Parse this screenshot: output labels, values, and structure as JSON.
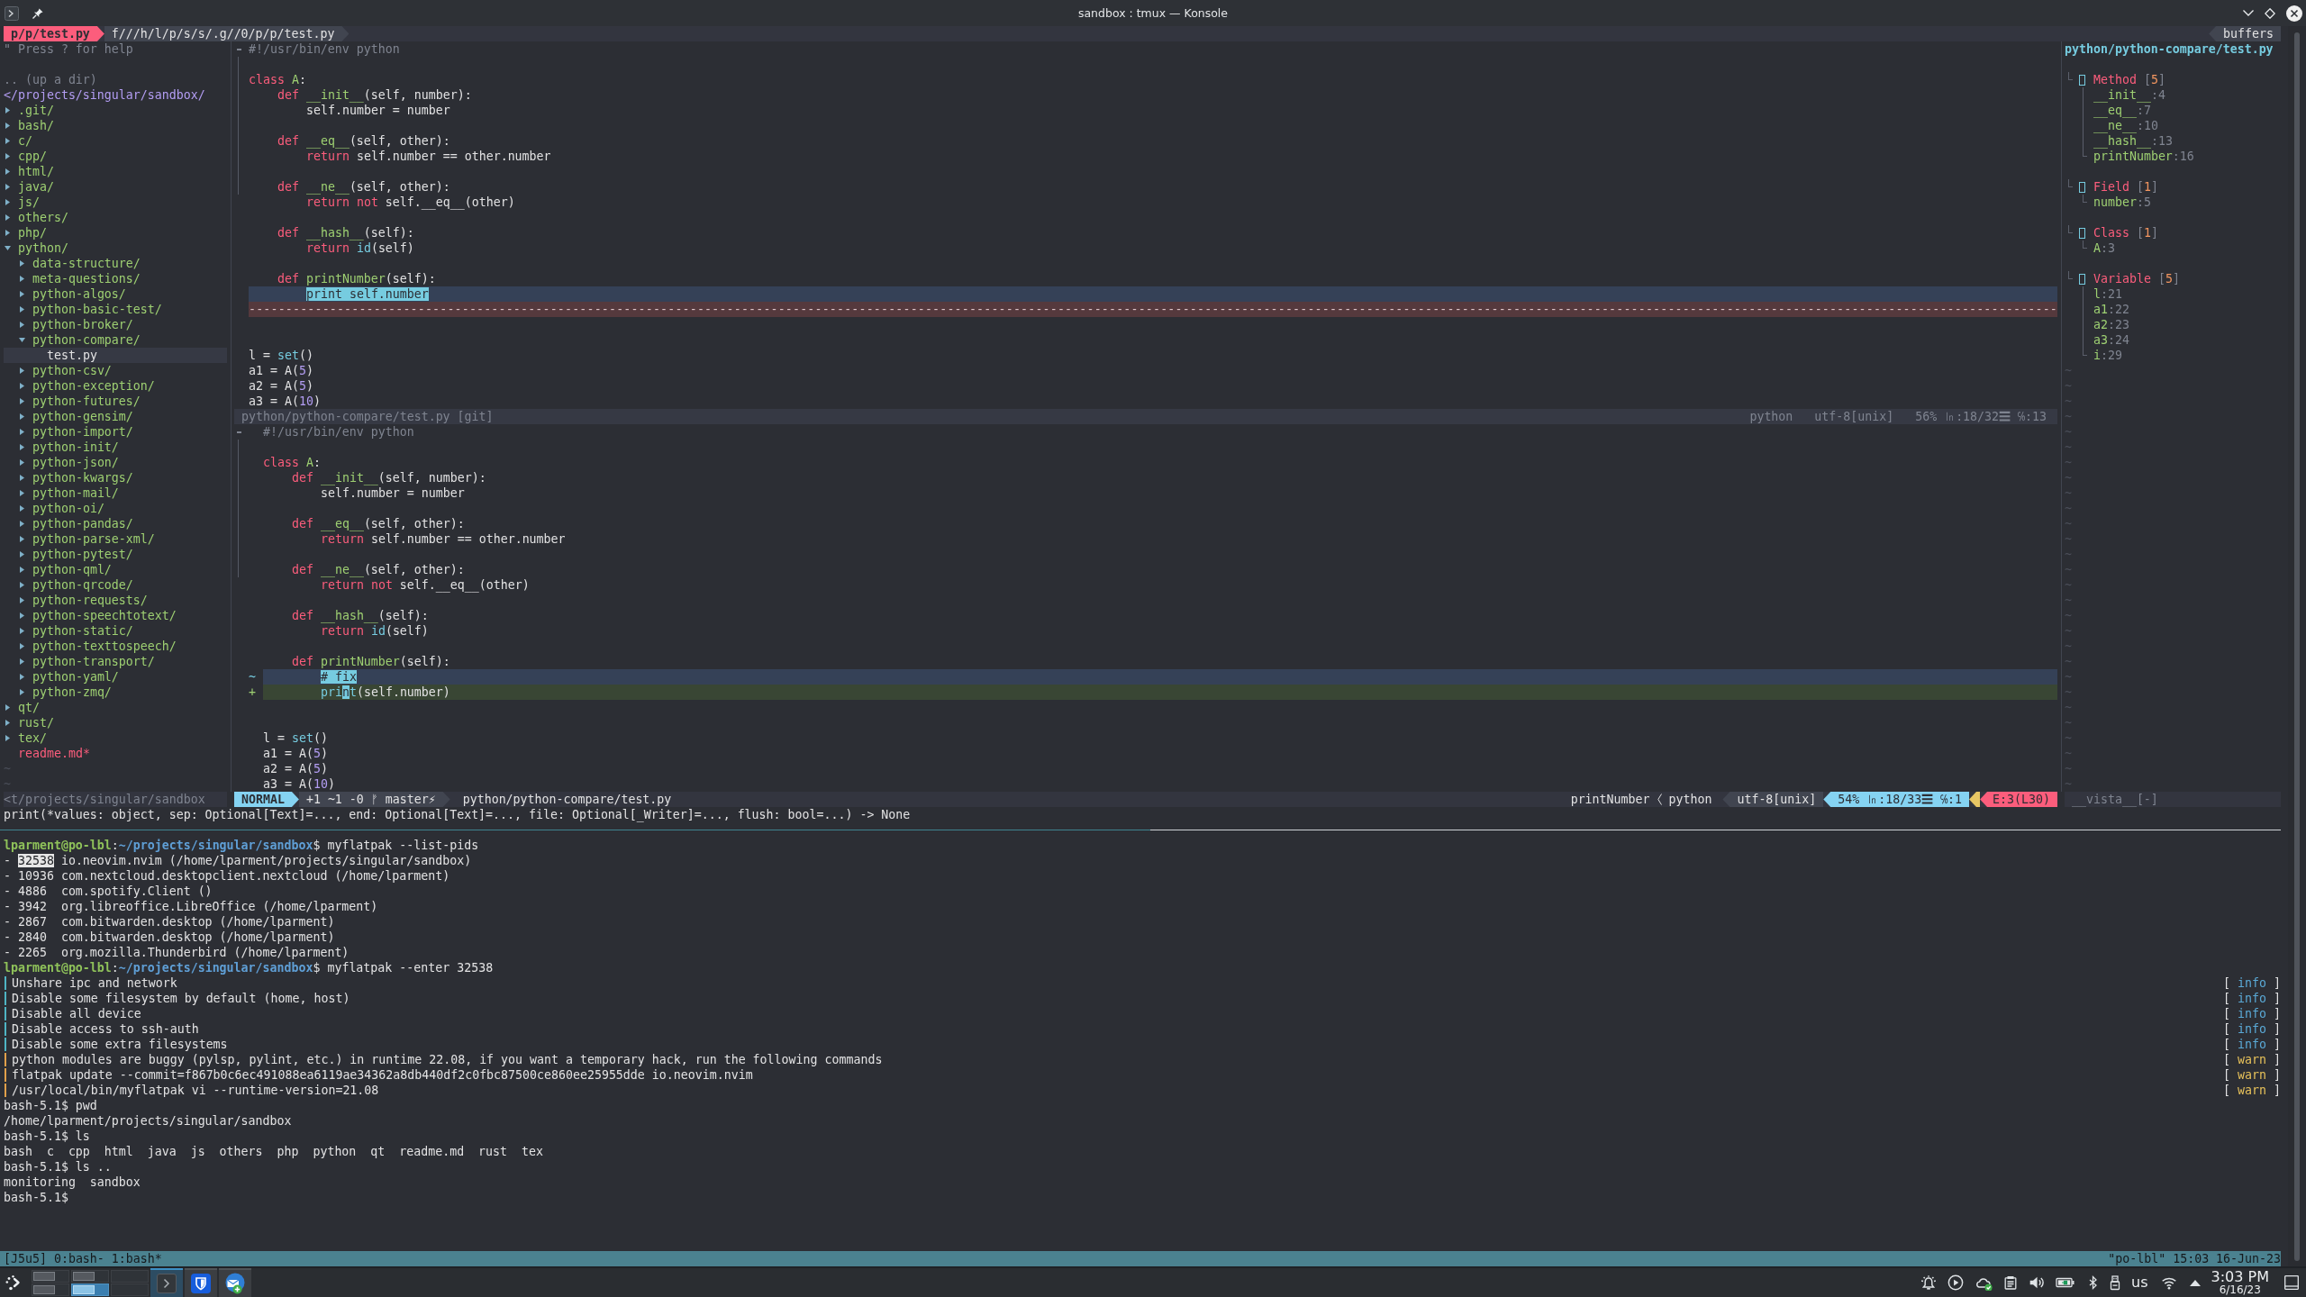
{
  "window": {
    "title": "sandbox : tmux — Konsole"
  },
  "tabline": {
    "tabs": [
      {
        "label": "p/p/test.py",
        "selected": true
      },
      {
        "label": "f///h/l/p/s/s/.g//0/p/p/test.py",
        "selected": false
      }
    ],
    "right_label": "buffers"
  },
  "file_tree": {
    "help": "\" Press ? for help",
    "up_dir": ".. (up a dir)",
    "root": "</projects/singular/sandbox/",
    "items": [
      {
        "kind": "folder",
        "name": ".git/",
        "expanded": false,
        "selected": false
      },
      {
        "kind": "folder",
        "name": "bash/",
        "expanded": false,
        "selected": false
      },
      {
        "kind": "folder",
        "name": "c/",
        "expanded": false,
        "selected": false
      },
      {
        "kind": "folder",
        "name": "cpp/",
        "expanded": false,
        "selected": false
      },
      {
        "kind": "folder",
        "name": "html/",
        "expanded": false,
        "selected": false
      },
      {
        "kind": "folder",
        "name": "java/",
        "expanded": false,
        "selected": false
      },
      {
        "kind": "folder",
        "name": "js/",
        "expanded": false,
        "selected": false
      },
      {
        "kind": "folder",
        "name": "others/",
        "expanded": false,
        "selected": false
      },
      {
        "kind": "folder",
        "name": "php/",
        "expanded": false,
        "selected": false
      },
      {
        "kind": "folder",
        "name": "python/",
        "expanded": true,
        "selected": false,
        "children": [
          {
            "kind": "folder",
            "name": "data-structure/",
            "expanded": false,
            "selected": false
          },
          {
            "kind": "folder",
            "name": "meta-questions/",
            "expanded": false,
            "selected": false
          },
          {
            "kind": "folder",
            "name": "python-algos/",
            "expanded": false,
            "selected": false
          },
          {
            "kind": "folder",
            "name": "python-basic-test/",
            "expanded": false,
            "selected": false
          },
          {
            "kind": "folder",
            "name": "python-broker/",
            "expanded": false,
            "selected": false
          },
          {
            "kind": "folder",
            "name": "python-compare/",
            "expanded": true,
            "selected": false,
            "children": [
              {
                "kind": "file",
                "name": "test.py",
                "selected": true,
                "color": "#e2e2e3"
              }
            ]
          },
          {
            "kind": "folder",
            "name": "python-csv/",
            "expanded": false,
            "selected": false
          },
          {
            "kind": "folder",
            "name": "python-exception/",
            "expanded": false,
            "selected": false
          },
          {
            "kind": "folder",
            "name": "python-futures/",
            "expanded": false,
            "selected": false
          },
          {
            "kind": "folder",
            "name": "python-gensim/",
            "expanded": false,
            "selected": false
          },
          {
            "kind": "folder",
            "name": "python-import/",
            "expanded": false,
            "selected": false
          },
          {
            "kind": "folder",
            "name": "python-init/",
            "expanded": false,
            "selected": false
          },
          {
            "kind": "folder",
            "name": "python-json/",
            "expanded": false,
            "selected": false
          },
          {
            "kind": "folder",
            "name": "python-kwargs/",
            "expanded": false,
            "selected": false
          },
          {
            "kind": "folder",
            "name": "python-mail/",
            "expanded": false,
            "selected": false
          },
          {
            "kind": "folder",
            "name": "python-oi/",
            "expanded": false,
            "selected": false
          },
          {
            "kind": "folder",
            "name": "python-pandas/",
            "expanded": false,
            "selected": false
          },
          {
            "kind": "folder",
            "name": "python-parse-xml/",
            "expanded": false,
            "selected": false
          },
          {
            "kind": "folder",
            "name": "python-pytest/",
            "expanded": false,
            "selected": false
          },
          {
            "kind": "folder",
            "name": "python-qml/",
            "expanded": false,
            "selected": false
          },
          {
            "kind": "folder",
            "name": "python-qrcode/",
            "expanded": false,
            "selected": false
          },
          {
            "kind": "folder",
            "name": "python-requests/",
            "expanded": false,
            "selected": false
          },
          {
            "kind": "folder",
            "name": "python-speechtotext/",
            "expanded": false,
            "selected": false
          },
          {
            "kind": "folder",
            "name": "python-static/",
            "expanded": false,
            "selected": false
          },
          {
            "kind": "folder",
            "name": "python-texttospeech/",
            "expanded": false,
            "selected": false
          },
          {
            "kind": "folder",
            "name": "python-transport/",
            "expanded": false,
            "selected": false
          },
          {
            "kind": "folder",
            "name": "python-yaml/",
            "expanded": false,
            "selected": false
          },
          {
            "kind": "folder",
            "name": "python-zmq/",
            "expanded": false,
            "selected": false
          }
        ]
      },
      {
        "kind": "folder",
        "name": "qt/",
        "expanded": false,
        "selected": false
      },
      {
        "kind": "folder",
        "name": "rust/",
        "expanded": false,
        "selected": false
      },
      {
        "kind": "folder",
        "name": "tex/",
        "expanded": false,
        "selected": false
      },
      {
        "kind": "file",
        "name": "readme.md*",
        "selected": false,
        "color": "#fc5d7c"
      }
    ],
    "filler": [
      "~",
      "~"
    ],
    "status": "<t/projects/singular/sandbox"
  },
  "editor": {
    "windows": [
      {
        "active": false,
        "lines": [
          {
            "kind": "code",
            "fold_start": true,
            "tokens": [
              {
                "kind": "comment",
                "text": "#!/usr/bin/env python"
              }
            ]
          },
          {
            "kind": "blank",
            "in_fold": true
          },
          {
            "kind": "code",
            "in_fold": true,
            "tokens": [
              {
                "kind": "keyword",
                "text": "class "
              },
              {
                "kind": "function",
                "text": "A"
              },
              {
                "kind": "plain",
                "text": ":"
              }
            ],
            "children": [
              {
                "kind": "code",
                "in_fold": true,
                "tokens": [
                  {
                    "kind": "keyword",
                    "text": "def "
                  },
                  {
                    "kind": "function",
                    "text": "__init__"
                  },
                  {
                    "kind": "plain",
                    "text": "(self, number):"
                  }
                ],
                "children": [
                  {
                    "kind": "code",
                    "in_fold": true,
                    "tokens": [
                      {
                        "kind": "plain",
                        "text": "self.number = number"
                      }
                    ]
                  }
                ]
              },
              {
                "kind": "blank",
                "in_fold": true
              },
              {
                "kind": "code",
                "in_fold": true,
                "tokens": [
                  {
                    "kind": "keyword",
                    "text": "def "
                  },
                  {
                    "kind": "function",
                    "text": "__eq__"
                  },
                  {
                    "kind": "plain",
                    "text": "(self, other):"
                  }
                ],
                "children": [
                  {
                    "kind": "code",
                    "in_fold": true,
                    "tokens": [
                      {
                        "kind": "keyword",
                        "text": "return"
                      },
                      {
                        "kind": "plain",
                        "text": " self.number == other.number"
                      }
                    ]
                  }
                ]
              },
              {
                "kind": "blank",
                "in_fold": true
              },
              {
                "kind": "code",
                "in_fold": true,
                "tokens": [
                  {
                    "kind": "keyword",
                    "text": "def "
                  },
                  {
                    "kind": "function",
                    "text": "__ne__"
                  },
                  {
                    "kind": "plain",
                    "text": "(self, other):"
                  }
                ],
                "children": [
                  {
                    "kind": "code",
                    "tokens": [
                      {
                        "kind": "keyword",
                        "text": "return not"
                      },
                      {
                        "kind": "plain",
                        "text": " self.__eq__(other)"
                      }
                    ]
                  }
                ]
              },
              {
                "kind": "blank"
              },
              {
                "kind": "code",
                "tokens": [
                  {
                    "kind": "keyword",
                    "text": "def "
                  },
                  {
                    "kind": "function",
                    "text": "__hash__"
                  },
                  {
                    "kind": "plain",
                    "text": "(self):"
                  }
                ],
                "children": [
                  {
                    "kind": "code",
                    "tokens": [
                      {
                        "kind": "keyword",
                        "text": "return "
                      },
                      {
                        "kind": "builtin",
                        "text": "id"
                      },
                      {
                        "kind": "plain",
                        "text": "(self)"
                      }
                    ]
                  }
                ]
              },
              {
                "kind": "blank"
              },
              {
                "kind": "code",
                "tokens": [
                  {
                    "kind": "keyword",
                    "text": "def "
                  },
                  {
                    "kind": "function",
                    "text": "printNumber"
                  },
                  {
                    "kind": "plain",
                    "text": "(self):"
                  }
                ],
                "children": [
                  {
                    "kind": "changed",
                    "tokens": [
                      {
                        "kind": "diff-text",
                        "text": "print self.number"
                      }
                    ]
                  }
                ]
              }
            ]
          },
          {
            "kind": "filler",
            "text": "------------------------------------------------------------------------------------------------------------------------------------------------------------------------------------------------------------------------------------------------------"
          },
          {
            "kind": "blank"
          },
          {
            "kind": "blank"
          },
          {
            "kind": "code",
            "tokens": [
              {
                "kind": "plain",
                "text": "l = "
              },
              {
                "kind": "builtin",
                "text": "set"
              },
              {
                "kind": "plain",
                "text": "()"
              }
            ]
          },
          {
            "kind": "code",
            "tokens": [
              {
                "kind": "plain",
                "text": "a1 = A("
              },
              {
                "kind": "number",
                "text": "5"
              },
              {
                "kind": "plain",
                "text": ")"
              }
            ]
          },
          {
            "kind": "code",
            "tokens": [
              {
                "kind": "plain",
                "text": "a2 = A("
              },
              {
                "kind": "number",
                "text": "5"
              },
              {
                "kind": "plain",
                "text": ")"
              }
            ]
          },
          {
            "kind": "code",
            "tokens": [
              {
                "kind": "plain",
                "text": "a3 = A("
              },
              {
                "kind": "number",
                "text": "10"
              },
              {
                "kind": "plain",
                "text": ")"
              }
            ]
          }
        ],
        "status": {
          "left": [
            {
              "kind": "file",
              "text": "python/python-compare/test.py [git]"
            }
          ],
          "right": [
            {
              "kind": "filetype",
              "text": "python"
            },
            {
              "kind": "encoding",
              "text": "utf-8[unix]"
            },
            {
              "kind": "position",
              "text": "56% ㏑:18/32☰ ℅:13"
            }
          ]
        }
      },
      {
        "active": true,
        "lines": [
          {
            "kind": "code",
            "fold_start": true,
            "tokens": [
              {
                "kind": "comment",
                "text": "#!/usr/bin/env python"
              }
            ]
          },
          {
            "kind": "blank",
            "in_fold": true
          },
          {
            "kind": "code",
            "in_fold": true,
            "tokens": [
              {
                "kind": "keyword",
                "text": "class "
              },
              {
                "kind": "function",
                "text": "A"
              },
              {
                "kind": "plain",
                "text": ":"
              }
            ],
            "children": [
              {
                "kind": "code",
                "in_fold": true,
                "tokens": [
                  {
                    "kind": "keyword",
                    "text": "def "
                  },
                  {
                    "kind": "function",
                    "text": "__init__"
                  },
                  {
                    "kind": "plain",
                    "text": "(self, number):"
                  }
                ],
                "children": [
                  {
                    "kind": "code",
                    "in_fold": true,
                    "tokens": [
                      {
                        "kind": "plain",
                        "text": "self.number = number"
                      }
                    ]
                  }
                ]
              },
              {
                "kind": "blank",
                "in_fold": true
              },
              {
                "kind": "code",
                "in_fold": true,
                "tokens": [
                  {
                    "kind": "keyword",
                    "text": "def "
                  },
                  {
                    "kind": "function",
                    "text": "__eq__"
                  },
                  {
                    "kind": "plain",
                    "text": "(self, other):"
                  }
                ],
                "children": [
                  {
                    "kind": "code",
                    "in_fold": true,
                    "tokens": [
                      {
                        "kind": "keyword",
                        "text": "return"
                      },
                      {
                        "kind": "plain",
                        "text": " self.number == other.number"
                      }
                    ]
                  }
                ]
              },
              {
                "kind": "blank",
                "in_fold": true
              },
              {
                "kind": "code",
                "in_fold": true,
                "tokens": [
                  {
                    "kind": "keyword",
                    "text": "def "
                  },
                  {
                    "kind": "function",
                    "text": "__ne__"
                  },
                  {
                    "kind": "plain",
                    "text": "(self, other):"
                  }
                ],
                "children": [
                  {
                    "kind": "code",
                    "tokens": [
                      {
                        "kind": "keyword",
                        "text": "return not"
                      },
                      {
                        "kind": "plain",
                        "text": " self.__eq__(other)"
                      }
                    ]
                  }
                ]
              },
              {
                "kind": "blank"
              },
              {
                "kind": "code",
                "tokens": [
                  {
                    "kind": "keyword",
                    "text": "def "
                  },
                  {
                    "kind": "function",
                    "text": "__hash__"
                  },
                  {
                    "kind": "plain",
                    "text": "(self):"
                  }
                ],
                "children": [
                  {
                    "kind": "code",
                    "tokens": [
                      {
                        "kind": "keyword",
                        "text": "return "
                      },
                      {
                        "kind": "builtin",
                        "text": "id"
                      },
                      {
                        "kind": "plain",
                        "text": "(self)"
                      }
                    ]
                  }
                ]
              },
              {
                "kind": "blank"
              },
              {
                "kind": "code",
                "tokens": [
                  {
                    "kind": "keyword",
                    "text": "def "
                  },
                  {
                    "kind": "function",
                    "text": "printNumber"
                  },
                  {
                    "kind": "plain",
                    "text": "(self):"
                  }
                ],
                "children": [
                  {
                    "kind": "changed",
                    "sign": "~",
                    "tokens": [
                      {
                        "kind": "diff-text",
                        "text": "# fix"
                      }
                    ]
                  },
                  {
                    "kind": "added",
                    "sign": "+",
                    "tokens": [
                      {
                        "kind": "builtin",
                        "text": "pri"
                      },
                      {
                        "kind": "cursor",
                        "text": "n"
                      },
                      {
                        "kind": "builtin",
                        "text": "t"
                      },
                      {
                        "kind": "plain",
                        "text": "(self.number)"
                      }
                    ]
                  }
                ]
              }
            ]
          },
          {
            "kind": "blank"
          },
          {
            "kind": "blank"
          },
          {
            "kind": "code",
            "tokens": [
              {
                "kind": "plain",
                "text": "l = "
              },
              {
                "kind": "builtin",
                "text": "set"
              },
              {
                "kind": "plain",
                "text": "()"
              }
            ]
          },
          {
            "kind": "code",
            "tokens": [
              {
                "kind": "plain",
                "text": "a1 = A("
              },
              {
                "kind": "number",
                "text": "5"
              },
              {
                "kind": "plain",
                "text": ")"
              }
            ]
          },
          {
            "kind": "code",
            "tokens": [
              {
                "kind": "plain",
                "text": "a2 = A("
              },
              {
                "kind": "number",
                "text": "5"
              },
              {
                "kind": "plain",
                "text": ")"
              }
            ]
          },
          {
            "kind": "code",
            "tokens": [
              {
                "kind": "plain",
                "text": "a3 = A("
              },
              {
                "kind": "number",
                "text": "10"
              },
              {
                "kind": "plain",
                "text": ")"
              }
            ]
          }
        ],
        "status": {
          "left": [
            {
              "kind": "mode",
              "text": "NORMAL"
            },
            {
              "kind": "git",
              "text": "+1 ~1 -0 ᚠ master⚡"
            },
            {
              "kind": "file",
              "text": "python/python-compare/test.py"
            }
          ],
          "right": [
            {
              "kind": "tag",
              "text": "printNumber"
            },
            {
              "kind": "filetype",
              "text": "python"
            },
            {
              "kind": "encoding",
              "text": "utf-8[unix]"
            },
            {
              "kind": "position",
              "text": "54% ㏑:18/33☰ ℅:1"
            },
            {
              "kind": "warning"
            },
            {
              "kind": "error",
              "text": "E:3(L30)"
            }
          ]
        }
      }
    ]
  },
  "tag_panel": {
    "title": "python/python-compare/test.py",
    "groups": [
      {
        "name": "Method",
        "count": "[5]",
        "children": [
          {
            "name": "__init__",
            "location": ":4"
          },
          {
            "name": "__eq__",
            "location": ":7"
          },
          {
            "name": "__ne__",
            "location": ":10"
          },
          {
            "name": "__hash__",
            "location": ":13"
          },
          {
            "name": "printNumber",
            "location": ":16"
          }
        ]
      },
      {
        "name": "Field",
        "count": "[1]",
        "children": [
          {
            "name": "number",
            "location": ":5"
          }
        ]
      },
      {
        "name": "Class",
        "count": "[1]",
        "children": [
          {
            "name": "A",
            "location": ":3"
          }
        ]
      },
      {
        "name": "Variable",
        "count": "[5]",
        "children": [
          {
            "name": "l",
            "location": ":21"
          },
          {
            "name": "a1",
            "location": ":22"
          },
          {
            "name": "a2",
            "location": ":23"
          },
          {
            "name": "a3",
            "location": ":24"
          },
          {
            "name": "i",
            "location": ":29"
          }
        ]
      }
    ],
    "filler": [
      "~",
      "~",
      "~",
      "~",
      "~",
      "~",
      "~",
      "~",
      "~",
      "~",
      "~",
      "~",
      "~",
      "~",
      "~",
      "~",
      "~",
      "~",
      "~",
      "~",
      "~",
      "~",
      "~",
      "~",
      "~",
      "~",
      "~",
      "~"
    ],
    "status": "__vista__[-]"
  },
  "command_line": "print(*values: object, sep: Optional[Text]=..., end: Optional[Text]=..., file: Optional[_Writer]=..., flush: bool=...) -> None",
  "shell": {
    "lines": [
      {
        "kind": "prompt",
        "user": "lparment@po-lbl",
        "separator": ":",
        "path": "~/projects/singular/sandbox",
        "command": "$ myflatpak --list-pids"
      },
      {
        "kind": "text",
        "segments": [
          {
            "text": "- ",
            "selected": false
          },
          {
            "text": "32538",
            "selected": true
          },
          {
            "text": " io.neovim.nvim (/home/lparment/projects/singular/sandbox)",
            "selected": false
          }
        ]
      },
      {
        "kind": "text",
        "segments": [
          {
            "text": "- 10936 com.nextcloud.desktopclient.nextcloud (/home/lparment)",
            "selected": false
          }
        ]
      },
      {
        "kind": "text",
        "segments": [
          {
            "text": "- 4886  com.spotify.Client ()",
            "selected": false
          }
        ]
      },
      {
        "kind": "text",
        "segments": [
          {
            "text": "- 3942  org.libreoffice.LibreOffice (/home/lparment)",
            "selected": false
          }
        ]
      },
      {
        "kind": "text",
        "segments": [
          {
            "text": "- 2867  com.bitwarden.desktop (/home/lparment)",
            "selected": false
          }
        ]
      },
      {
        "kind": "text",
        "segments": [
          {
            "text": "- 2840  com.bitwarden.desktop (/home/lparment)",
            "selected": false
          }
        ]
      },
      {
        "kind": "text",
        "segments": [
          {
            "text": "- 2265  org.mozilla.Thunderbird (/home/lparment)",
            "selected": false
          }
        ]
      },
      {
        "kind": "prompt",
        "user": "lparment@po-lbl",
        "separator": ":",
        "path": "~/projects/singular/sandbox",
        "command": "$ myflatpak --enter 32538"
      },
      {
        "kind": "info",
        "text": "Unshare ipc and network",
        "tag": "[ info ]"
      },
      {
        "kind": "info",
        "text": "Disable some filesystem by default (home, host)",
        "tag": "[ info ]"
      },
      {
        "kind": "info",
        "text": "Disable all device",
        "tag": "[ info ]"
      },
      {
        "kind": "info",
        "text": "Disable access to ssh-auth",
        "tag": "[ info ]"
      },
      {
        "kind": "info",
        "text": "Disable some extra filesystems",
        "tag": "[ info ]"
      },
      {
        "kind": "warn",
        "text": "python modules are buggy (pylsp, pylint, etc.) in runtime 22.08, if you want a temporary hack, run the following commands",
        "tag": "[ warn ]"
      },
      {
        "kind": "warn",
        "text": "flatpak update --commit=f867b0c6ec491088ea6119ae34362a8db440df2c0fbc87500ce860ee25955dde io.neovim.nvim",
        "tag": "[ warn ]"
      },
      {
        "kind": "warn",
        "text": "/usr/local/bin/myflatpak vi --runtime-version=21.08",
        "tag": "[ warn ]"
      },
      {
        "kind": "text",
        "segments": [
          {
            "text": "bash-5.1$ pwd",
            "selected": false
          }
        ]
      },
      {
        "kind": "text",
        "segments": [
          {
            "text": "/home/lparment/projects/singular/sandbox",
            "selected": false
          }
        ]
      },
      {
        "kind": "text",
        "segments": [
          {
            "text": "bash-5.1$ ls",
            "selected": false
          }
        ]
      },
      {
        "kind": "text",
        "segments": [
          {
            "text": "bash  c  cpp  html  java  js  others  php  python  qt  readme.md  rust  tex",
            "selected": false
          }
        ]
      },
      {
        "kind": "text",
        "segments": [
          {
            "text": "bash-5.1$ ls ..",
            "selected": false
          }
        ]
      },
      {
        "kind": "text",
        "segments": [
          {
            "text": "monitoring  sandbox",
            "selected": false
          }
        ]
      },
      {
        "kind": "text",
        "segments": [
          {
            "text": "bash-5.1$",
            "selected": false
          }
        ]
      }
    ]
  },
  "tmux_status": {
    "session": "[J5u5]",
    "windows": [
      "0:bash-",
      "1:bash*"
    ],
    "right": "\"po-lbl\" 15:03 16-Jun-23"
  },
  "taskbar": {
    "desktops": [
      {
        "selected": false,
        "occupied": true
      },
      {
        "selected": false,
        "occupied": true
      },
      {
        "selected": false,
        "occupied": false
      },
      {
        "selected": false,
        "occupied": true
      },
      {
        "selected": true,
        "occupied": true
      },
      {
        "selected": false,
        "occupied": false
      }
    ],
    "tasks": [
      {
        "kind": "terminal",
        "selected": true
      },
      {
        "kind": "shield",
        "selected": false
      },
      {
        "kind": "mail",
        "selected": false
      }
    ],
    "keyboard_layout": "us",
    "time": "3:03 PM",
    "date": "6/16/23"
  }
}
